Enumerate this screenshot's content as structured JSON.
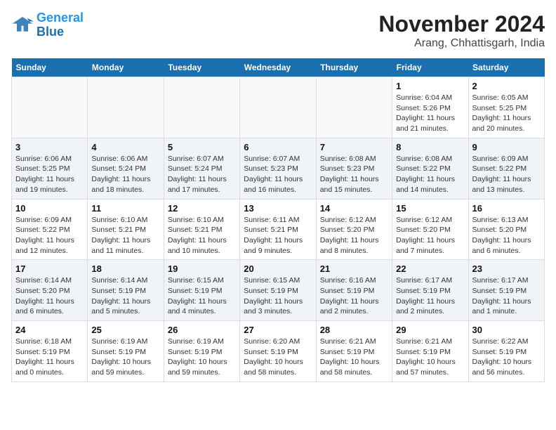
{
  "logo": {
    "line1": "General",
    "line2": "Blue"
  },
  "title": "November 2024",
  "subtitle": "Arang, Chhattisgarh, India",
  "weekdays": [
    "Sunday",
    "Monday",
    "Tuesday",
    "Wednesday",
    "Thursday",
    "Friday",
    "Saturday"
  ],
  "weeks": [
    [
      {
        "day": "",
        "info": ""
      },
      {
        "day": "",
        "info": ""
      },
      {
        "day": "",
        "info": ""
      },
      {
        "day": "",
        "info": ""
      },
      {
        "day": "",
        "info": ""
      },
      {
        "day": "1",
        "info": "Sunrise: 6:04 AM\nSunset: 5:26 PM\nDaylight: 11 hours\nand 21 minutes."
      },
      {
        "day": "2",
        "info": "Sunrise: 6:05 AM\nSunset: 5:25 PM\nDaylight: 11 hours\nand 20 minutes."
      }
    ],
    [
      {
        "day": "3",
        "info": "Sunrise: 6:06 AM\nSunset: 5:25 PM\nDaylight: 11 hours\nand 19 minutes."
      },
      {
        "day": "4",
        "info": "Sunrise: 6:06 AM\nSunset: 5:24 PM\nDaylight: 11 hours\nand 18 minutes."
      },
      {
        "day": "5",
        "info": "Sunrise: 6:07 AM\nSunset: 5:24 PM\nDaylight: 11 hours\nand 17 minutes."
      },
      {
        "day": "6",
        "info": "Sunrise: 6:07 AM\nSunset: 5:23 PM\nDaylight: 11 hours\nand 16 minutes."
      },
      {
        "day": "7",
        "info": "Sunrise: 6:08 AM\nSunset: 5:23 PM\nDaylight: 11 hours\nand 15 minutes."
      },
      {
        "day": "8",
        "info": "Sunrise: 6:08 AM\nSunset: 5:22 PM\nDaylight: 11 hours\nand 14 minutes."
      },
      {
        "day": "9",
        "info": "Sunrise: 6:09 AM\nSunset: 5:22 PM\nDaylight: 11 hours\nand 13 minutes."
      }
    ],
    [
      {
        "day": "10",
        "info": "Sunrise: 6:09 AM\nSunset: 5:22 PM\nDaylight: 11 hours\nand 12 minutes."
      },
      {
        "day": "11",
        "info": "Sunrise: 6:10 AM\nSunset: 5:21 PM\nDaylight: 11 hours\nand 11 minutes."
      },
      {
        "day": "12",
        "info": "Sunrise: 6:10 AM\nSunset: 5:21 PM\nDaylight: 11 hours\nand 10 minutes."
      },
      {
        "day": "13",
        "info": "Sunrise: 6:11 AM\nSunset: 5:21 PM\nDaylight: 11 hours\nand 9 minutes."
      },
      {
        "day": "14",
        "info": "Sunrise: 6:12 AM\nSunset: 5:20 PM\nDaylight: 11 hours\nand 8 minutes."
      },
      {
        "day": "15",
        "info": "Sunrise: 6:12 AM\nSunset: 5:20 PM\nDaylight: 11 hours\nand 7 minutes."
      },
      {
        "day": "16",
        "info": "Sunrise: 6:13 AM\nSunset: 5:20 PM\nDaylight: 11 hours\nand 6 minutes."
      }
    ],
    [
      {
        "day": "17",
        "info": "Sunrise: 6:14 AM\nSunset: 5:20 PM\nDaylight: 11 hours\nand 6 minutes."
      },
      {
        "day": "18",
        "info": "Sunrise: 6:14 AM\nSunset: 5:19 PM\nDaylight: 11 hours\nand 5 minutes."
      },
      {
        "day": "19",
        "info": "Sunrise: 6:15 AM\nSunset: 5:19 PM\nDaylight: 11 hours\nand 4 minutes."
      },
      {
        "day": "20",
        "info": "Sunrise: 6:15 AM\nSunset: 5:19 PM\nDaylight: 11 hours\nand 3 minutes."
      },
      {
        "day": "21",
        "info": "Sunrise: 6:16 AM\nSunset: 5:19 PM\nDaylight: 11 hours\nand 2 minutes."
      },
      {
        "day": "22",
        "info": "Sunrise: 6:17 AM\nSunset: 5:19 PM\nDaylight: 11 hours\nand 2 minutes."
      },
      {
        "day": "23",
        "info": "Sunrise: 6:17 AM\nSunset: 5:19 PM\nDaylight: 11 hours\nand 1 minute."
      }
    ],
    [
      {
        "day": "24",
        "info": "Sunrise: 6:18 AM\nSunset: 5:19 PM\nDaylight: 11 hours\nand 0 minutes."
      },
      {
        "day": "25",
        "info": "Sunrise: 6:19 AM\nSunset: 5:19 PM\nDaylight: 10 hours\nand 59 minutes."
      },
      {
        "day": "26",
        "info": "Sunrise: 6:19 AM\nSunset: 5:19 PM\nDaylight: 10 hours\nand 59 minutes."
      },
      {
        "day": "27",
        "info": "Sunrise: 6:20 AM\nSunset: 5:19 PM\nDaylight: 10 hours\nand 58 minutes."
      },
      {
        "day": "28",
        "info": "Sunrise: 6:21 AM\nSunset: 5:19 PM\nDaylight: 10 hours\nand 58 minutes."
      },
      {
        "day": "29",
        "info": "Sunrise: 6:21 AM\nSunset: 5:19 PM\nDaylight: 10 hours\nand 57 minutes."
      },
      {
        "day": "30",
        "info": "Sunrise: 6:22 AM\nSunset: 5:19 PM\nDaylight: 10 hours\nand 56 minutes."
      }
    ]
  ]
}
